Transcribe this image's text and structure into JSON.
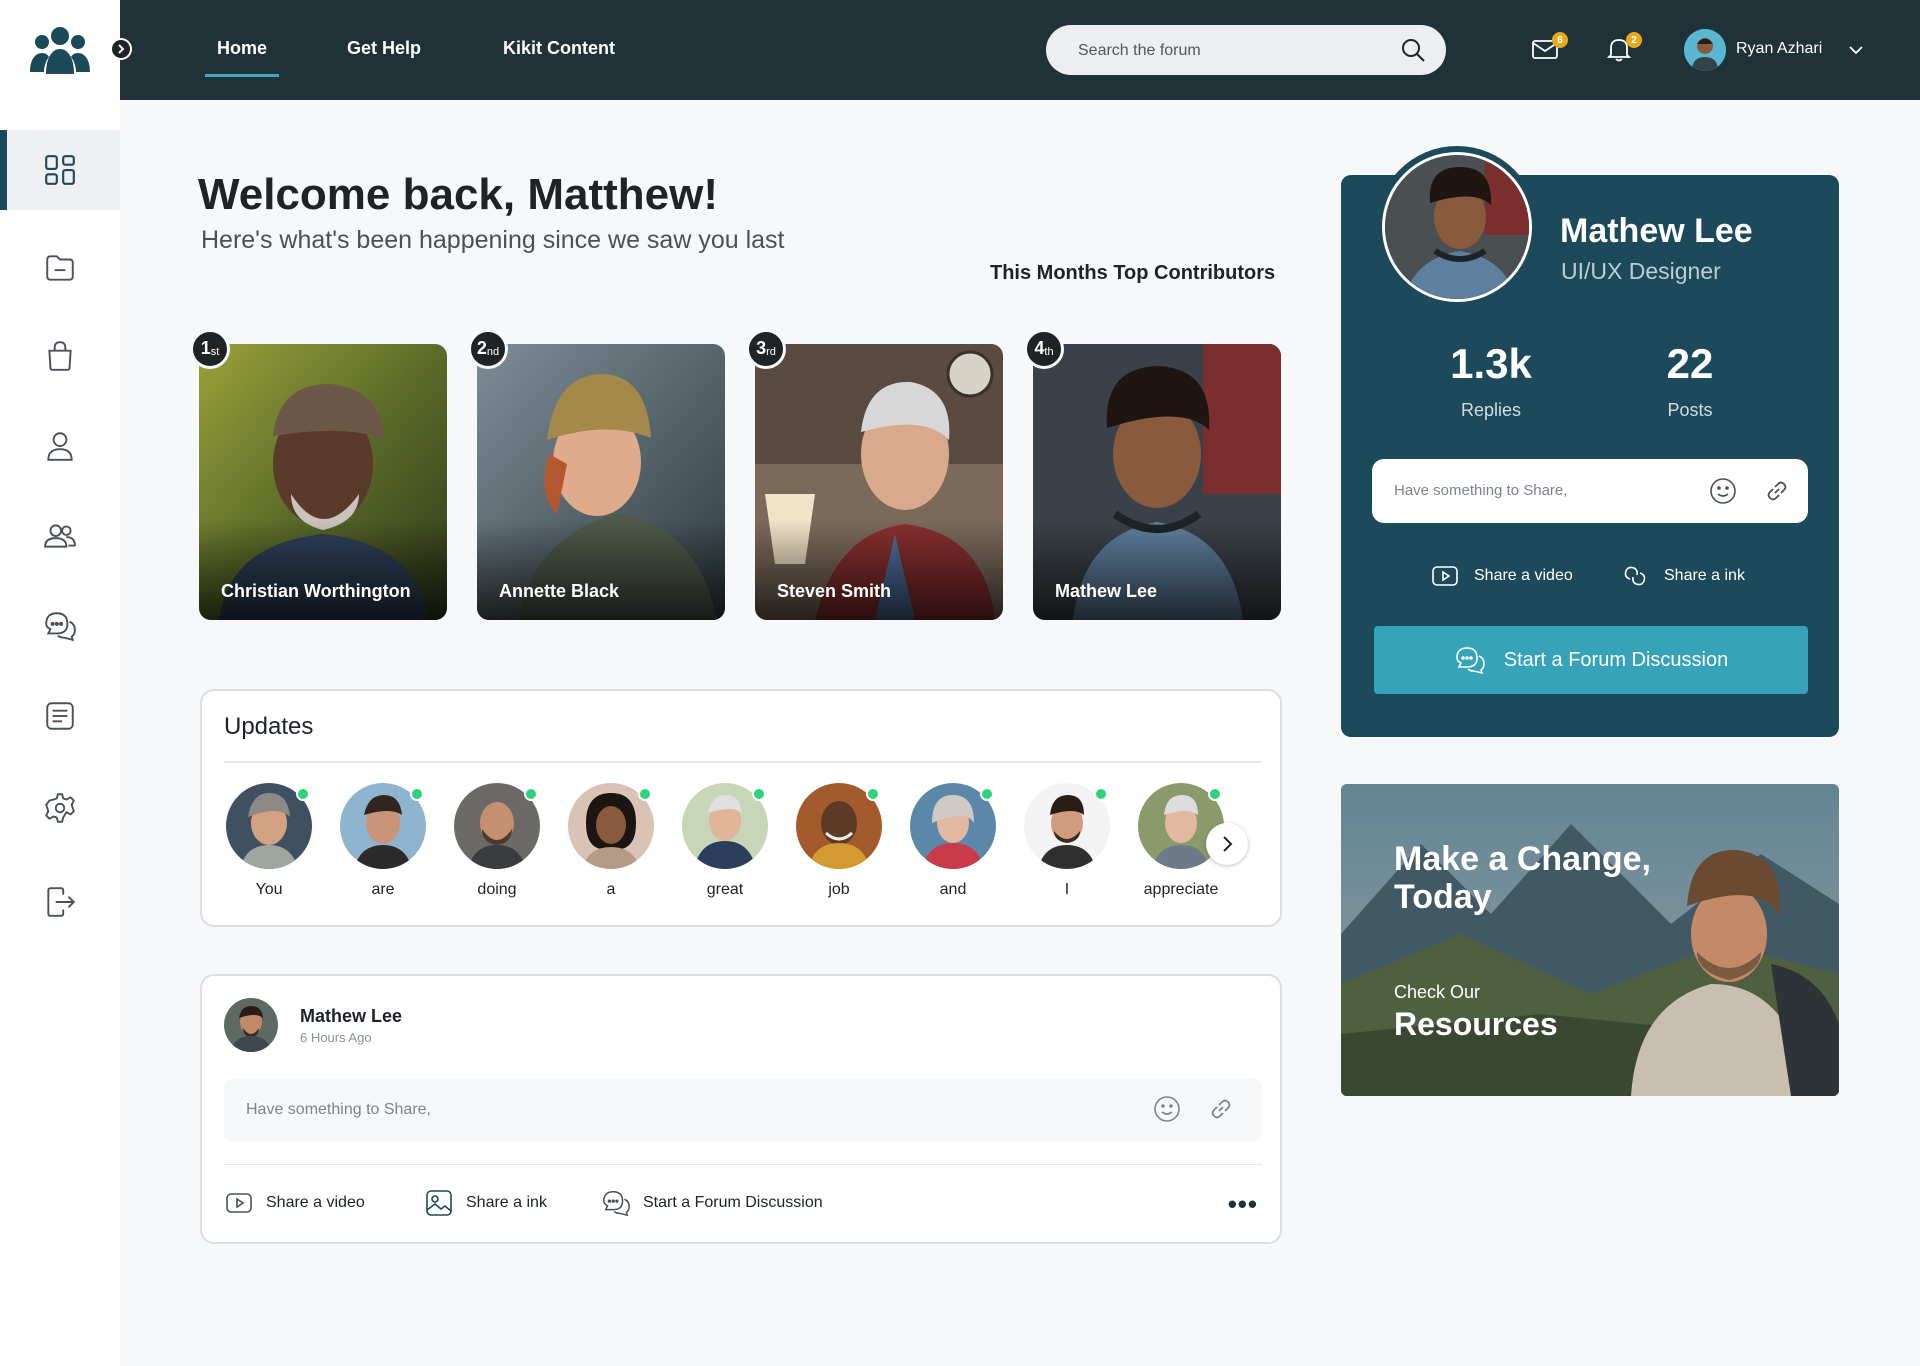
{
  "topbar": {
    "tabs": [
      {
        "label": "Home"
      },
      {
        "label": "Get Help"
      },
      {
        "label": "Kikit Content"
      }
    ],
    "search_placeholder": "Search the forum",
    "mail_count": "6",
    "notification_count": "2",
    "user_name": "Ryan Azhari"
  },
  "welcome": {
    "title": "Welcome back, Matthew!",
    "subtitle": "Here's what's been happening since we saw you last",
    "top_contributors_label": "This Months Top Contributors"
  },
  "contributors": [
    {
      "rank": "1",
      "suffix": "st",
      "name": "Christian Worthington"
    },
    {
      "rank": "2",
      "suffix": "nd",
      "name": "Annette Black"
    },
    {
      "rank": "3",
      "suffix": "rd",
      "name": "Steven Smith"
    },
    {
      "rank": "4",
      "suffix": "th",
      "name": "Mathew Lee"
    }
  ],
  "updates": {
    "title": "Updates",
    "stories": [
      {
        "label": "You"
      },
      {
        "label": "are"
      },
      {
        "label": "doing"
      },
      {
        "label": "a"
      },
      {
        "label": "great"
      },
      {
        "label": "job"
      },
      {
        "label": "and"
      },
      {
        "label": "I"
      },
      {
        "label": "appreciate"
      }
    ]
  },
  "post": {
    "author": "Mathew Lee",
    "time": "6 Hours Ago",
    "placeholder": "Have something to Share,",
    "actions": {
      "video": "Share a video",
      "link": "Share a ink",
      "forum": "Start a Forum Discussion"
    }
  },
  "profile": {
    "name": "Mathew Lee",
    "role": "UI/UX Designer",
    "replies_value": "1.3k",
    "replies_label": "Replies",
    "posts_value": "22",
    "posts_label": "Posts",
    "placeholder": "Have something to Share,",
    "share_video": "Share a video",
    "share_link": "Share a ink",
    "forum_button": "Start a Forum Discussion"
  },
  "promo": {
    "title": "Make a Change, Today",
    "small": "Check Our",
    "big": "Resources"
  },
  "colors": {
    "topbar": "#1f3238",
    "profile_card": "#1c4a5a",
    "accent": "#36a3b8",
    "badge": "#e9a91d",
    "online": "#2ed47a"
  }
}
